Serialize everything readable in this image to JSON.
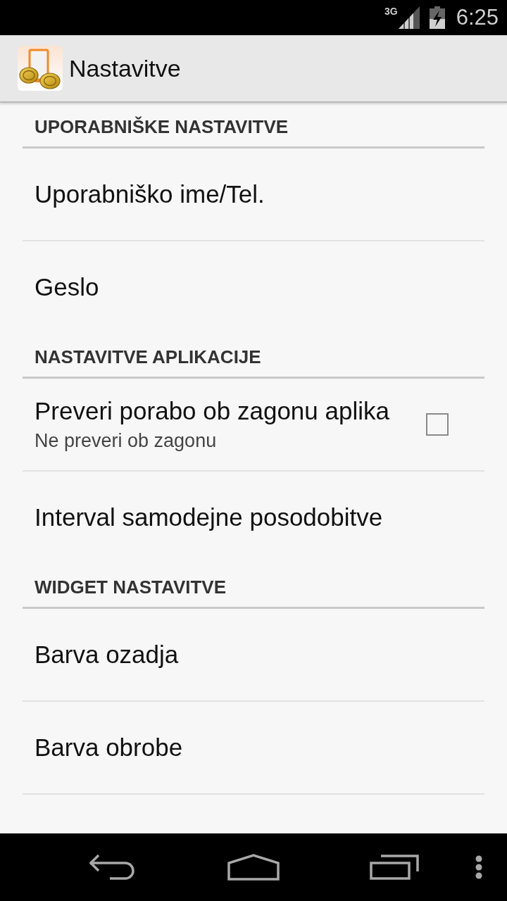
{
  "status_bar": {
    "network": "3G",
    "time": "6:25"
  },
  "app_bar": {
    "title": "Nastavitve"
  },
  "sections": [
    {
      "title": "UPORABNIŠKE NASTAVITVE",
      "items": [
        {
          "kind": "plain",
          "title": "Uporabniško ime/Tel."
        },
        {
          "kind": "plain",
          "title": "Geslo"
        }
      ]
    },
    {
      "title": "NASTAVITVE APLIKACIJE",
      "items": [
        {
          "kind": "checkbox",
          "title": "Preveri porabo ob zagonu aplika",
          "summary": "Ne preveri ob zagonu",
          "checked": false
        },
        {
          "kind": "plain",
          "title": "Interval samodejne posodobitve"
        }
      ]
    },
    {
      "title": "WIDGET NASTAVITVE",
      "items": [
        {
          "kind": "plain",
          "title": "Barva ozadja"
        },
        {
          "kind": "plain",
          "title": "Barva obrobe"
        }
      ]
    }
  ]
}
